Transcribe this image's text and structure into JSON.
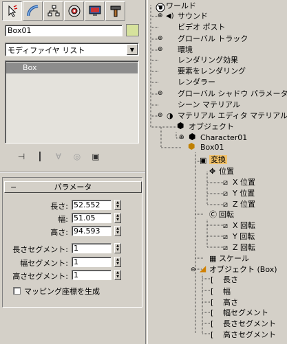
{
  "panel": {
    "tabs": [
      "create",
      "modify",
      "hierarchy",
      "motion",
      "display",
      "utilities"
    ],
    "object_name": "Box01",
    "object_color": "#d6e29c",
    "modifier_list": "モディファイヤ リスト",
    "stack_items": [
      "Box"
    ],
    "rollout_title": "パラメータ",
    "params": [
      {
        "label": "長さ:",
        "value": "52.552"
      },
      {
        "label": "幅:",
        "value": "51.05"
      },
      {
        "label": "高さ:",
        "value": "94.593"
      }
    ],
    "segments": [
      {
        "label": "長さセグメント:",
        "value": "1"
      },
      {
        "label": "幅セグメント:",
        "value": "1"
      },
      {
        "label": "高さセグメント:",
        "value": "1"
      }
    ],
    "mapping_label": "マッピング座標を生成"
  },
  "tree": {
    "nodes": [
      {
        "text": "ワールド"
      },
      {
        "text": "サウンド"
      },
      {
        "text": "ビデオ ポスト"
      },
      {
        "text": "グローバル トラック"
      },
      {
        "text": "環境"
      },
      {
        "text": "レンダリング効果"
      },
      {
        "text": "要素をレンダリング"
      },
      {
        "text": "レンダラー"
      },
      {
        "text": "グローバル シャドウ パラメータ"
      },
      {
        "text": "シーン マテリアル"
      },
      {
        "text": "マテリアル エディタ マテリアル"
      },
      {
        "text": "オブジェクト"
      },
      {
        "text": "Character01"
      },
      {
        "text": "Box01"
      },
      {
        "text": "変換"
      },
      {
        "text": "位置"
      },
      {
        "text": "X 位置"
      },
      {
        "text": "Y 位置"
      },
      {
        "text": "Z 位置"
      },
      {
        "text": "回転"
      },
      {
        "text": "X 回転"
      },
      {
        "text": "Y 回転"
      },
      {
        "text": "Z 回転"
      },
      {
        "text": "スケール"
      },
      {
        "text": "オブジェクト (Box)"
      },
      {
        "text": "長さ"
      },
      {
        "text": "幅"
      },
      {
        "text": "高さ"
      },
      {
        "text": "幅セグメント"
      },
      {
        "text": "長さセグメント"
      },
      {
        "text": "高さセグメント"
      }
    ]
  },
  "colors": {
    "highlight": "#f2c26a",
    "stack_selected": "#8c8c8c"
  }
}
